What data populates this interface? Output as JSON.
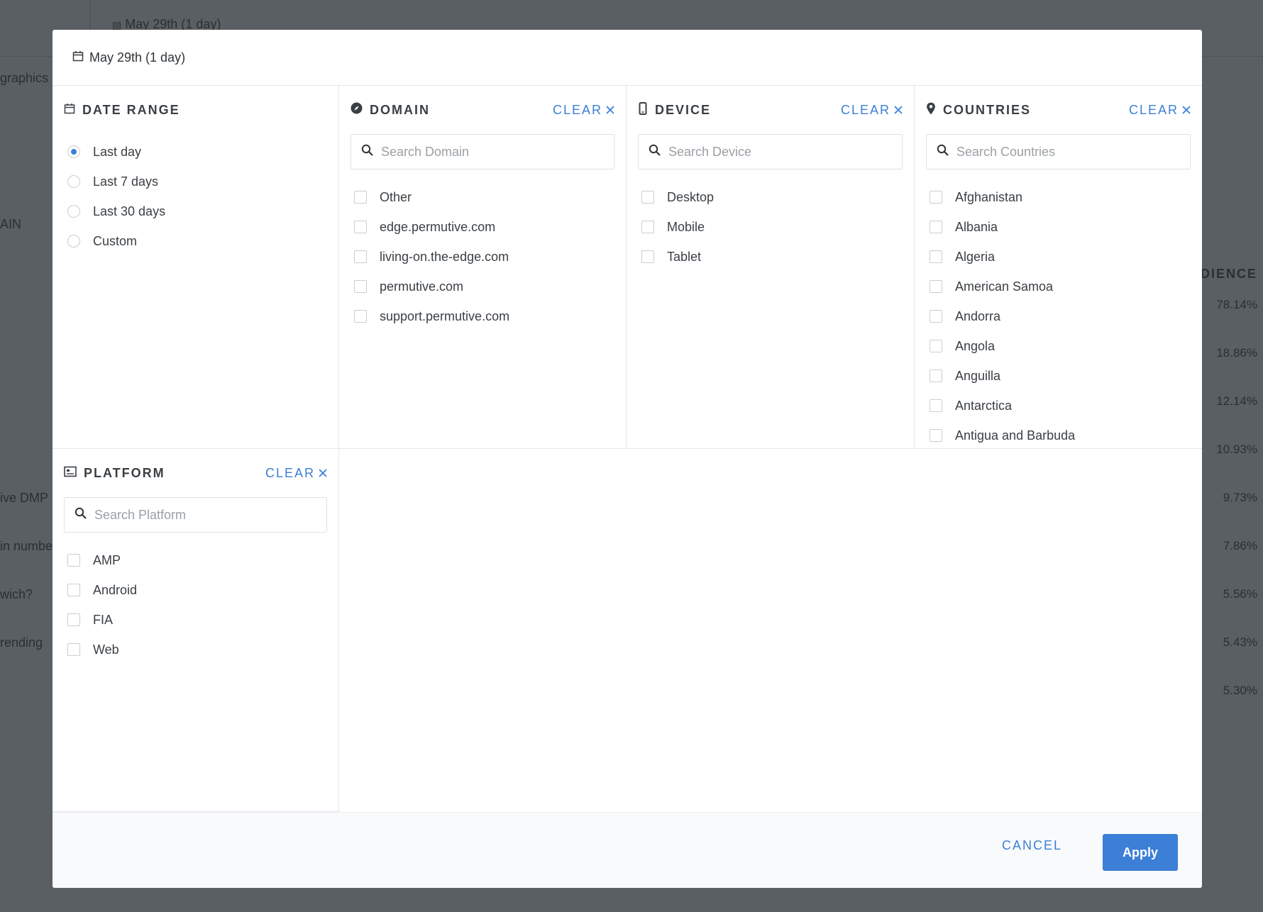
{
  "background": {
    "date_label": "May 29th (1 day)",
    "left_fragments": [
      "graphics",
      "AIN",
      "ive DMP",
      "in numbe",
      "wich?",
      "rending"
    ],
    "audience_header": "DIENCE",
    "percentages": [
      "78.14%",
      "18.86%",
      "12.14%",
      "10.93%",
      "9.73%",
      "7.86%",
      "5.56%",
      "5.43%",
      "5.30%"
    ]
  },
  "modal": {
    "date_label": "May 29th (1 day)",
    "date_range": {
      "title": "DATE RANGE",
      "options": [
        {
          "label": "Last day",
          "selected": true
        },
        {
          "label": "Last 7 days",
          "selected": false
        },
        {
          "label": "Last 30 days",
          "selected": false
        },
        {
          "label": "Custom",
          "selected": false
        }
      ]
    },
    "domain": {
      "title": "DOMAIN",
      "clear_label": "CLEAR",
      "search_placeholder": "Search Domain",
      "options": [
        "Other",
        "edge.permutive.com",
        "living-on.the-edge.com",
        "permutive.com",
        "support.permutive.com"
      ]
    },
    "device": {
      "title": "DEVICE",
      "clear_label": "CLEAR",
      "search_placeholder": "Search Device",
      "options": [
        "Desktop",
        "Mobile",
        "Tablet"
      ]
    },
    "countries": {
      "title": "COUNTRIES",
      "clear_label": "CLEAR",
      "search_placeholder": "Search Countries",
      "options": [
        "Afghanistan",
        "Albania",
        "Algeria",
        "American Samoa",
        "Andorra",
        "Angola",
        "Anguilla",
        "Antarctica",
        "Antigua and Barbuda"
      ]
    },
    "platform": {
      "title": "PLATFORM",
      "clear_label": "CLEAR",
      "search_placeholder": "Search Platform",
      "options": [
        "AMP",
        "Android",
        "FIA",
        "Web"
      ]
    },
    "footer": {
      "cancel_label": "CANCEL",
      "apply_label": "Apply"
    }
  },
  "colors": {
    "accent": "#3c7fd6",
    "overlay": "#565b5f",
    "border": "#e3e6ea"
  }
}
